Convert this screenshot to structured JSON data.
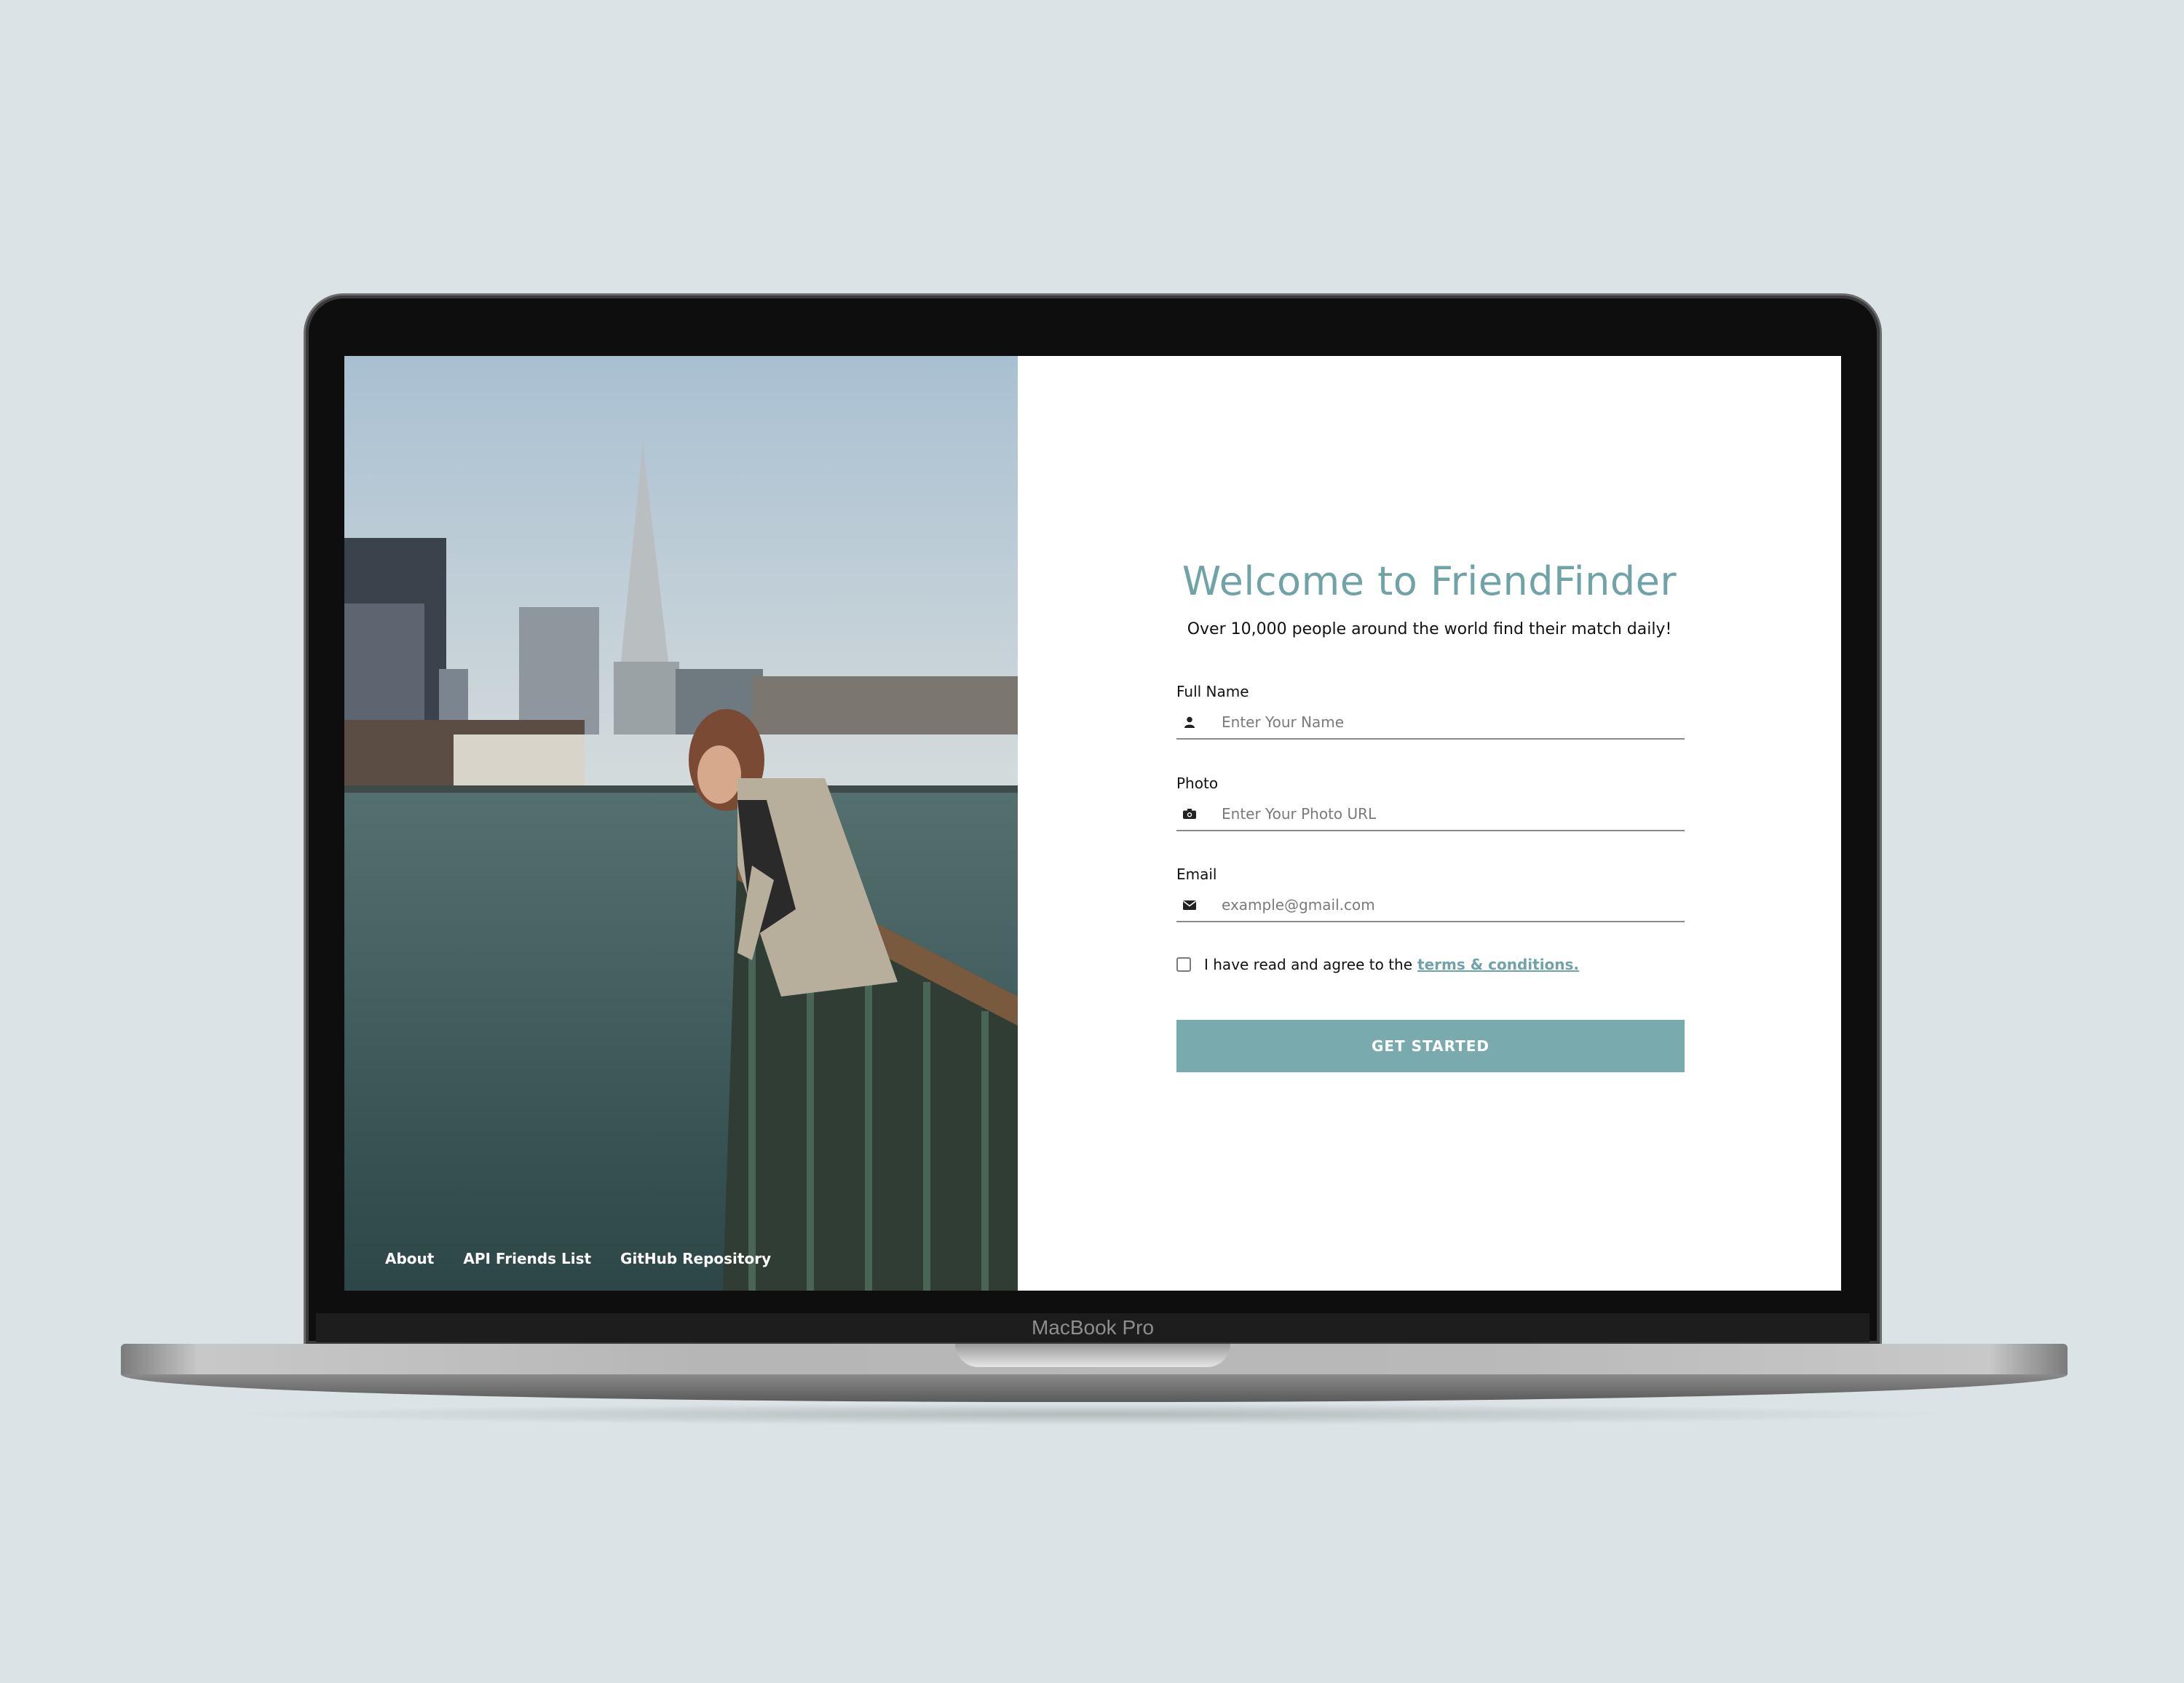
{
  "device": {
    "brand_label": "MacBook Pro"
  },
  "footer_nav": [
    {
      "label": "About"
    },
    {
      "label": "API Friends List"
    },
    {
      "label": "GitHub Repository"
    }
  ],
  "form": {
    "title": "Welcome to FriendFinder",
    "subtitle": "Over 10,000 people around the world find their match daily!",
    "fields": [
      {
        "label": "Full Name",
        "placeholder": "Enter Your Name",
        "icon": "user-icon"
      },
      {
        "label": "Photo",
        "placeholder": "Enter Your Photo URL",
        "icon": "camera-icon"
      },
      {
        "label": "Email",
        "placeholder": "example@gmail.com",
        "icon": "envelope-icon"
      }
    ],
    "terms": {
      "text": "I have read and agree to the",
      "link": "terms & conditions.",
      "checked": false
    },
    "submit_label": "GET STARTED"
  },
  "colors": {
    "accent": "#6fa3a8",
    "button": "#79aaad",
    "background": "#dbe3e6"
  }
}
